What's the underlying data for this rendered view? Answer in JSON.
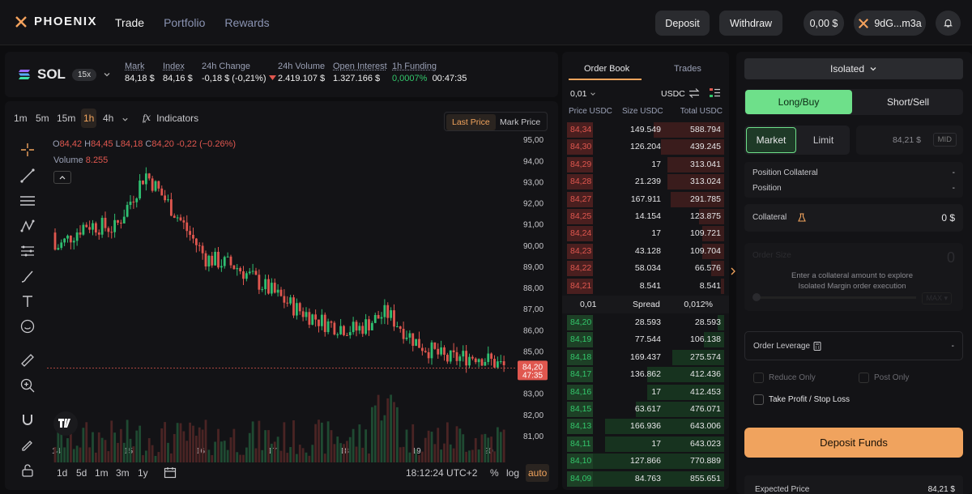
{
  "header": {
    "brand": "PHOENIX",
    "nav": [
      "Trade",
      "Portfolio",
      "Rewards"
    ],
    "deposit": "Deposit",
    "withdraw": "Withdraw",
    "balance": "0,00 $",
    "wallet": "9dG...m3a"
  },
  "market": {
    "symbol": "SOL",
    "leverage": "15x",
    "stats": [
      {
        "label": "Mark",
        "value": "84,18 $"
      },
      {
        "label": "Index",
        "value": "84,16 $"
      },
      {
        "label": "24h Change",
        "value": "-0,18 $ (-0,21%)"
      },
      {
        "label": "24h Volume",
        "value": "2.419.107 $"
      },
      {
        "label": "Open Interest",
        "value": "1.327.166 $"
      },
      {
        "label": "1h Funding",
        "value": "0,0007%",
        "extra": "00:47:35"
      }
    ]
  },
  "chart": {
    "timeframes": [
      "1m",
      "5m",
      "15m",
      "1h",
      "4h"
    ],
    "active_tf": "1h",
    "indicators": "Indicators",
    "price_modes": [
      "Last Price",
      "Mark Price"
    ],
    "ohlc": {
      "o": "84,42",
      "h": "84,45",
      "l": "84,18",
      "c": "84,20",
      "chg": "-0,22 (−0.26%)"
    },
    "volume_label": "Volume",
    "volume_value": "8.255",
    "y_ticks": [
      "95,00",
      "94,00",
      "93,00",
      "92,00",
      "91,00",
      "90,00",
      "89,00",
      "88,00",
      "87,00",
      "86,00",
      "85,00",
      "84,00",
      "83,00",
      "82,00",
      "81,00"
    ],
    "x_ticks": [
      "14",
      "15",
      "16",
      "17",
      "18",
      "19",
      "20"
    ],
    "last_price": "84,20",
    "countdown": "47:35",
    "ranges": [
      "1d",
      "5d",
      "1m",
      "3m",
      "1y"
    ],
    "time": "18:12:24 UTC+2",
    "scale_opts": [
      "%",
      "log",
      "auto"
    ],
    "colors": {
      "up": "#2fbf71",
      "down": "#e0574f"
    }
  },
  "chart_data": {
    "type": "candlestick",
    "title": "",
    "x": [
      "14",
      "15",
      "16",
      "17",
      "18",
      "19",
      "20"
    ],
    "ylim": [
      80.5,
      95.2
    ],
    "last": 84.2,
    "range_by_day": [
      {
        "day": "14",
        "low": 89.5,
        "high": 91.6
      },
      {
        "day": "15",
        "low": 88.6,
        "high": 93.6
      },
      {
        "day": "16",
        "low": 85.7,
        "high": 90.0
      },
      {
        "day": "17",
        "low": 85.4,
        "high": 87.1
      },
      {
        "day": "18",
        "low": 81.0,
        "high": 86.3
      },
      {
        "day": "19",
        "low": 83.5,
        "high": 85.4
      }
    ]
  },
  "orderbook": {
    "tabs": [
      "Order Book",
      "Trades"
    ],
    "tick": "0,01",
    "currency": "USDC",
    "cols": [
      "Price USDC",
      "Size USDC",
      "Total USDC"
    ],
    "asks": [
      {
        "p": "84,34",
        "s": "149.549",
        "t": "588.794",
        "d": 0.45
      },
      {
        "p": "84,30",
        "s": "126.204",
        "t": "439.245",
        "d": 0.4
      },
      {
        "p": "84,29",
        "s": "17",
        "t": "313.041",
        "d": 0.36
      },
      {
        "p": "84,28",
        "s": "21.239",
        "t": "313.024",
        "d": 0.36
      },
      {
        "p": "84,27",
        "s": "167.911",
        "t": "291.785",
        "d": 0.34
      },
      {
        "p": "84,25",
        "s": "14.154",
        "t": "123.875",
        "d": 0.16
      },
      {
        "p": "84,24",
        "s": "17",
        "t": "109.721",
        "d": 0.14
      },
      {
        "p": "84,23",
        "s": "43.128",
        "t": "109.704",
        "d": 0.14
      },
      {
        "p": "84,22",
        "s": "58.034",
        "t": "66.576",
        "d": 0.08
      },
      {
        "p": "84,21",
        "s": "8.541",
        "t": "8.541",
        "d": 0.02
      }
    ],
    "spread": {
      "tick": "0,01",
      "label": "Spread",
      "pct": "0,012%"
    },
    "bids": [
      {
        "p": "84,20",
        "s": "28.593",
        "t": "28.593",
        "d": 0.04
      },
      {
        "p": "84,19",
        "s": "77.544",
        "t": "106.138",
        "d": 0.13
      },
      {
        "p": "84,18",
        "s": "169.437",
        "t": "275.574",
        "d": 0.33
      },
      {
        "p": "84,17",
        "s": "136.862",
        "t": "412.436",
        "d": 0.49
      },
      {
        "p": "84,16",
        "s": "17",
        "t": "412.453",
        "d": 0.49
      },
      {
        "p": "84,15",
        "s": "63.617",
        "t": "476.071",
        "d": 0.56
      },
      {
        "p": "84,13",
        "s": "166.936",
        "t": "643.006",
        "d": 0.76
      },
      {
        "p": "84,11",
        "s": "17",
        "t": "643.023",
        "d": 0.76
      },
      {
        "p": "84,10",
        "s": "127.866",
        "t": "770.889",
        "d": 0.9
      },
      {
        "p": "84,09",
        "s": "84.763",
        "t": "855.651",
        "d": 1.0
      }
    ]
  },
  "order": {
    "margin": "Isolated",
    "sides": [
      "Long/Buy",
      "Short/Sell"
    ],
    "types": [
      "Market",
      "Limit"
    ],
    "price": "84,21 $",
    "mid": "MID",
    "position_collateral": "Position Collateral",
    "position": "Position",
    "dash": "-",
    "collateral": "Collateral",
    "collateral_value": "0 $",
    "order_size": "Order Size",
    "hint": "Enter a collateral amount to explore Isolated Margin order execution",
    "leverage": "Order Leverage",
    "reduce_only": "Reduce Only",
    "post_only": "Post Only",
    "tpsl": "Take Profit / Stop Loss",
    "deposit_funds": "Deposit Funds",
    "expected_price": "Expected Price",
    "expected_value": "84,21 $",
    "faded": [
      "0",
      "MAX ▾"
    ]
  }
}
